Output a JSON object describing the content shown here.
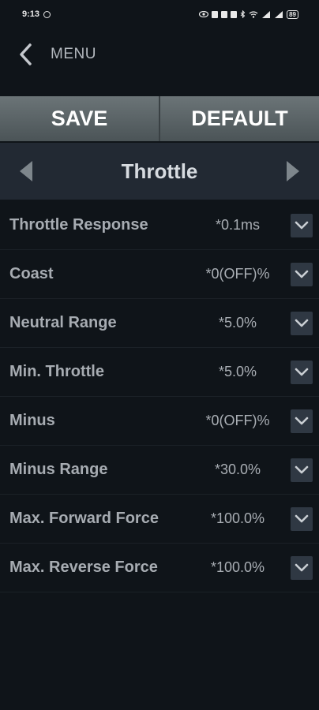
{
  "status_bar": {
    "time": "9:13",
    "battery": "89",
    "icons": [
      "media-circle-icon",
      "eye-icon",
      "notification-icon",
      "notification-icon",
      "notification-icon",
      "bluetooth-icon",
      "wifi-icon",
      "signal-icon",
      "signal-icon",
      "battery-icon"
    ]
  },
  "topbar": {
    "back_icon": "chevron-left-icon",
    "menu_label": "MENU"
  },
  "actions": {
    "save_label": "SAVE",
    "default_label": "DEFAULT"
  },
  "selector": {
    "title": "Throttle",
    "prev_icon": "triangle-left-icon",
    "next_icon": "triangle-right-icon"
  },
  "settings": [
    {
      "label": "Throttle Response",
      "value": "*0.1ms"
    },
    {
      "label": "Coast",
      "value": "*0(OFF)%"
    },
    {
      "label": "Neutral Range",
      "value": "*5.0%"
    },
    {
      "label": "Min. Throttle",
      "value": "*5.0%"
    },
    {
      "label": "Minus",
      "value": "*0(OFF)%"
    },
    {
      "label": "Minus Range",
      "value": "*30.0%"
    },
    {
      "label": "Max. Forward Force",
      "value": "*100.0%"
    },
    {
      "label": "Max. Reverse Force",
      "value": "*100.0%"
    }
  ],
  "colors": {
    "background": "#0f1419",
    "action_bar": "#5b6467",
    "selector_bg": "#222933",
    "dropdown_bg": "#2f3843"
  }
}
